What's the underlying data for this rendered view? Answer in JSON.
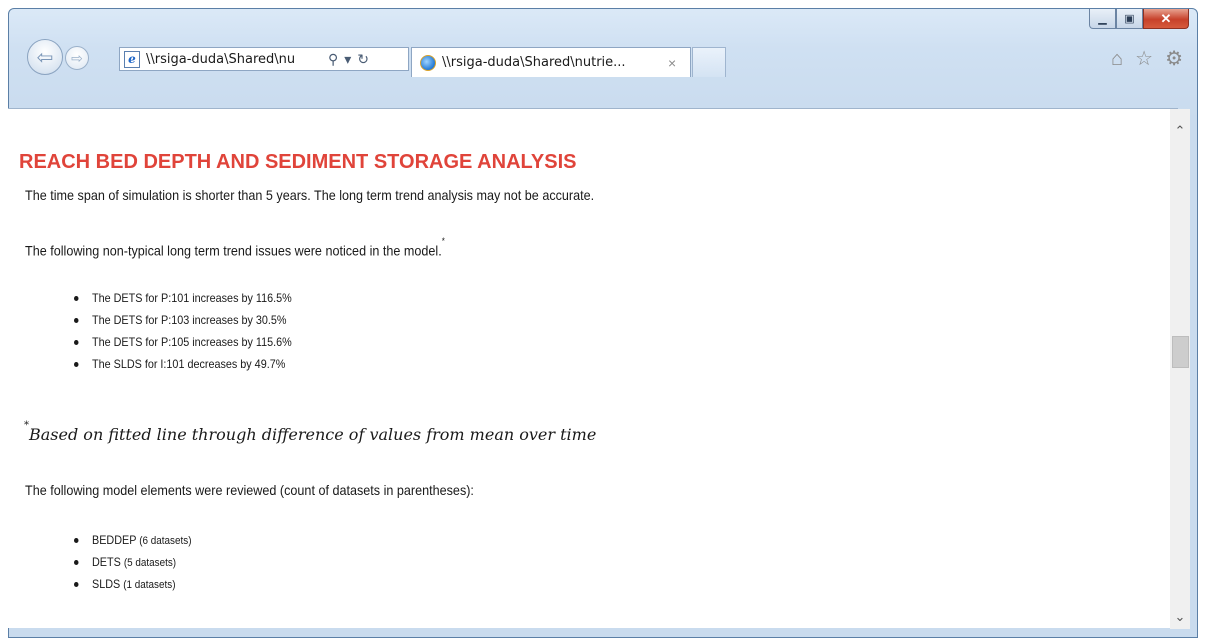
{
  "browser": {
    "address_text": "\\\\rsiga-duda\\Shared\\nu",
    "address_search_symbol": "⚲",
    "address_dropdown_symbol": "▾",
    "address_refresh_symbol": "↻",
    "tab_title": "\\\\rsiga-duda\\Shared\\nutrie...",
    "tab_close_symbol": "×",
    "back_symbol": "⇦",
    "forward_symbol": "⇨",
    "minimize_symbol": "▁",
    "maximize_symbol": "▣",
    "close_symbol": "✕",
    "home_symbol": "⌂",
    "favorites_symbol": "☆",
    "tools_symbol": "⚙",
    "icons": {
      "back": "arrow-left-icon",
      "forward": "arrow-right-icon",
      "page": "ie-page-icon",
      "tab": "ie-logo-icon",
      "home": "home-icon",
      "favorites": "star-icon",
      "tools": "gear-icon"
    }
  },
  "page": {
    "title": "REACH BED DEPTH AND SEDIMENT STORAGE ANALYSIS",
    "title_color": "#e0443a",
    "intro": "The time span of simulation is shorter than 5 years. The long term trend analysis may not be accurate.",
    "issues_heading": "The following non-typical long term trend issues were noticed in the model.",
    "issues_marker": "*",
    "issues": [
      "The DETS for P:101 increases by 116.5%",
      "The DETS for P:103 increases by 30.5%",
      "The DETS for P:105 increases by 115.6%",
      "The SLDS for I:101 decreases by 49.7%"
    ],
    "footnote_marker": "*",
    "footnote": "Based on fitted line through difference of values from mean over time",
    "elements_heading": "The following model elements were reviewed (count of datasets in parentheses):",
    "elements": [
      {
        "name": "BEDDEP",
        "count": "(6 datasets)"
      },
      {
        "name": "DETS",
        "count": "(5 datasets)"
      },
      {
        "name": "SLDS",
        "count": "(1 datasets)"
      }
    ]
  },
  "scrollbar": {
    "up_symbol": "⌃",
    "down_symbol": "⌄",
    "position_fraction": 0.45
  }
}
